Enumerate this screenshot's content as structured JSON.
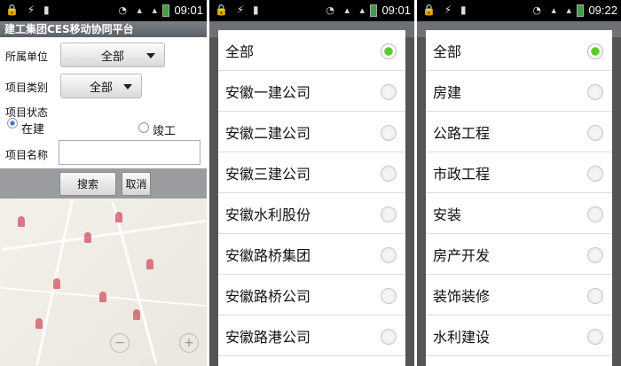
{
  "screen1": {
    "status": {
      "time": "09:01"
    },
    "app_title": "建工集团CES移动协同平台",
    "unit_label": "所属单位",
    "unit_value": "全部",
    "category_label": "项目类别",
    "category_value": "全部",
    "status_label": "项目状态",
    "status_options": [
      {
        "label": "在建",
        "selected": true
      },
      {
        "label": "竣工",
        "selected": false
      }
    ],
    "name_label": "项目名称",
    "name_value": "",
    "search_button": "搜索",
    "cancel_button": "取消"
  },
  "screen2": {
    "status": {
      "time": "09:01"
    },
    "options": [
      {
        "label": "全部",
        "selected": true
      },
      {
        "label": "安徽一建公司",
        "selected": false
      },
      {
        "label": "安徽二建公司",
        "selected": false
      },
      {
        "label": "安徽三建公司",
        "selected": false
      },
      {
        "label": "安徽水利股份",
        "selected": false
      },
      {
        "label": "安徽路桥集团",
        "selected": false
      },
      {
        "label": "安徽路桥公司",
        "selected": false
      },
      {
        "label": "安徽路港公司",
        "selected": false
      }
    ]
  },
  "screen3": {
    "status": {
      "time": "09:22"
    },
    "options": [
      {
        "label": "全部",
        "selected": true
      },
      {
        "label": "房建",
        "selected": false
      },
      {
        "label": "公路工程",
        "selected": false
      },
      {
        "label": "市政工程",
        "selected": false
      },
      {
        "label": "安装",
        "selected": false
      },
      {
        "label": "房产开发",
        "selected": false
      },
      {
        "label": "装饰装修",
        "selected": false
      },
      {
        "label": "水利建设",
        "selected": false
      }
    ]
  }
}
